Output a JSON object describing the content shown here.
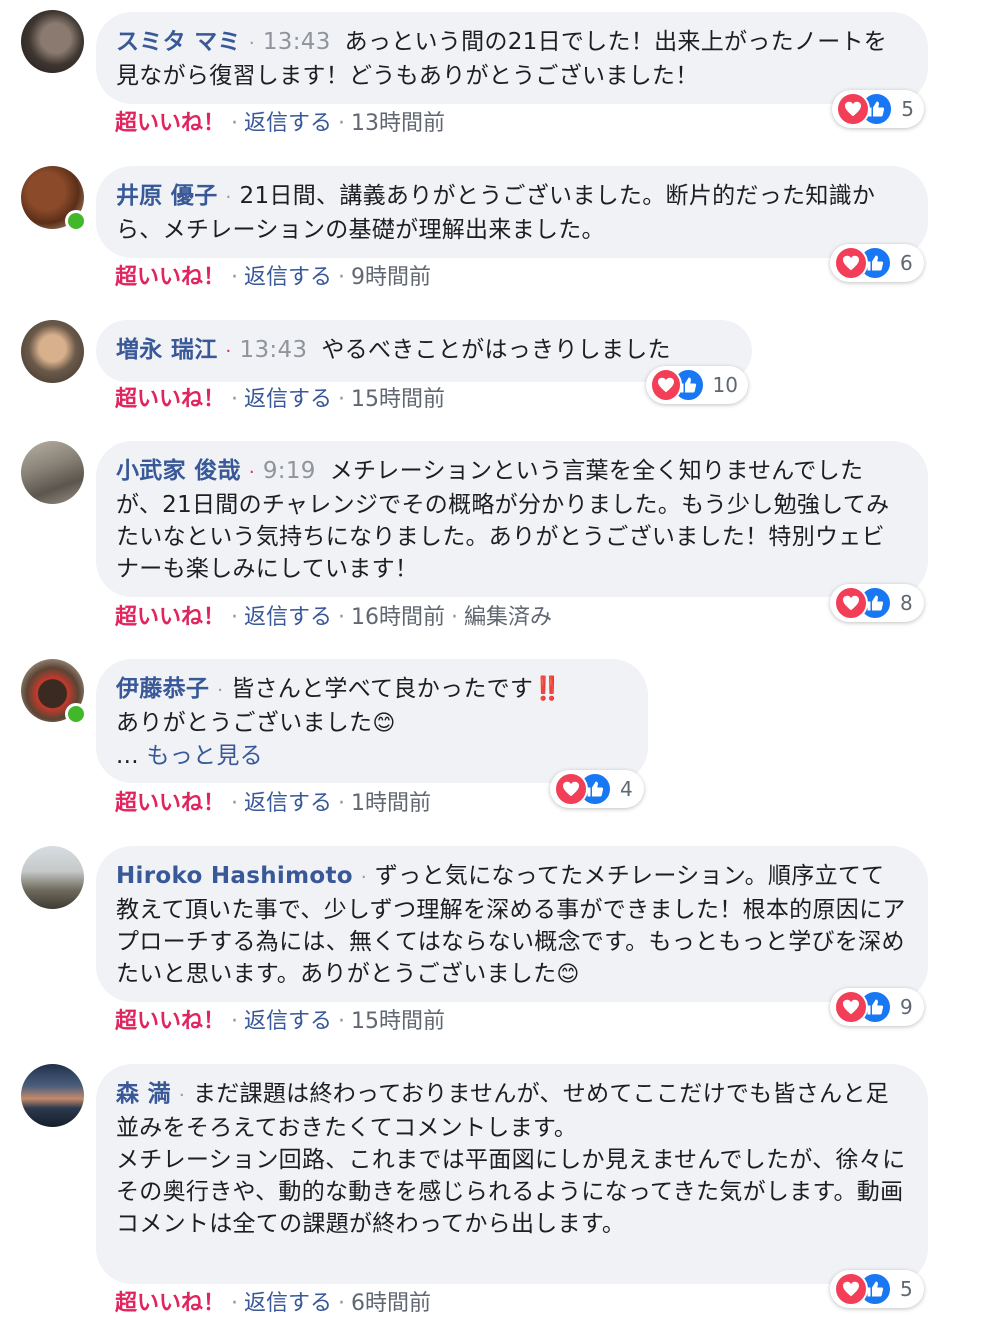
{
  "actions": {
    "like": "超いいね！",
    "reply": "返信する",
    "dot": "·"
  },
  "comments": [
    {
      "name": "スミタ マミ",
      "time": "13:43",
      "text": "あっという間の21日でした！出来上がったノートを見ながら復習します！どうもありがとうございました！",
      "ago": "13時間前",
      "reactions": "5"
    },
    {
      "name": "井原 優子",
      "time": "",
      "text": "21日間、講義ありがとうございました。断片的だった知識から、メチレーションの基礎が理解出来ました。",
      "ago": "9時間前",
      "reactions": "6"
    },
    {
      "name": "増永 瑞江",
      "time": "13:43",
      "text": "やるべきことがはっきりしました",
      "ago": "15時間前",
      "reactions": "10"
    },
    {
      "name": "小武家 俊哉",
      "time": "9:19",
      "text": "メチレーションという言葉を全く知りませんでしたが、21日間のチャレンジでその概略が分かりました。もう少し勉強してみたいなという気持ちになりました。ありがとうございました！特別ウェビナーも楽しみにしています！",
      "ago": "16時間前",
      "edited": "編集済み",
      "reactions": "8"
    },
    {
      "name": "伊藤恭子",
      "time": "",
      "text": "皆さんと学べて良かったです",
      "text_bang": "‼️",
      "text2": "ありがとうございました",
      "emoji": "😊",
      "more_prefix": "... ",
      "more": "もっと見る",
      "ago": "1時間前",
      "reactions": "4"
    },
    {
      "name": "Hiroko Hashimoto",
      "time": "",
      "text": "ずっと気になってたメチレーション。順序立てて教えて頂いた事で、少しずつ理解を深める事ができました！根本的原因にアプローチする為には、無くてはならない概念です。もっともっと学びを深めたいと思います。ありがとうございました",
      "emoji": "😊",
      "ago": "15時間前",
      "reactions": "9"
    },
    {
      "name": "森 満",
      "time": "",
      "text": "まだ課題は終わっておりませんが、せめてここだけでも皆さんと足並みをそろえておきたくてコメントします。",
      "text2": "メチレーション回路、これまでは平面図にしか見えませんでしたが、徐々にその奥行きや、動的な動きを感じられるようになってきた気がします。動画コメントは全ての課題が終わってから出します。",
      "ago": "6時間前",
      "reactions": "5"
    }
  ],
  "colors": {
    "name": "#385898",
    "like": "#e0245e",
    "bubble": "#f0f2f5",
    "love": "#f33e58",
    "thumb": "#1877f2"
  }
}
